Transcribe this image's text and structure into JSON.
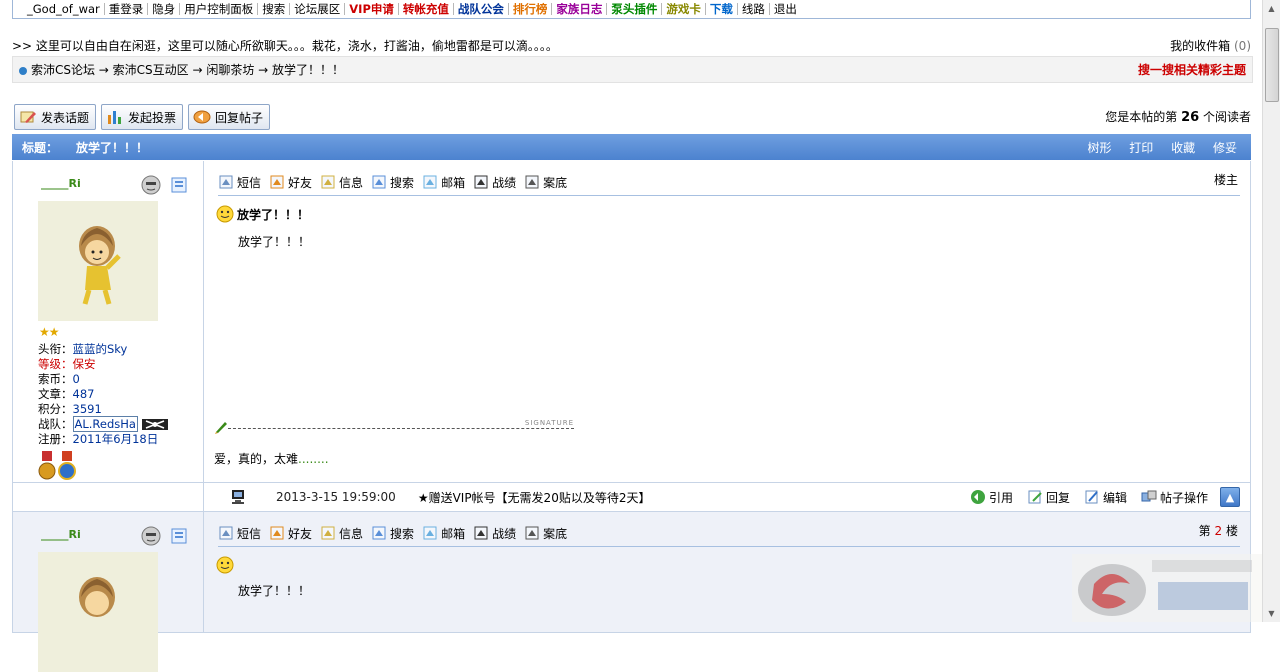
{
  "nav": {
    "items": [
      {
        "label": "_God_of_war",
        "color": "#000000",
        "bold": false
      },
      {
        "label": "重登录",
        "color": "#000000",
        "bold": false
      },
      {
        "label": "隐身",
        "color": "#000000",
        "bold": false
      },
      {
        "label": "用户控制面板",
        "color": "#000000",
        "bold": false
      },
      {
        "label": "搜索",
        "color": "#000000",
        "bold": false
      },
      {
        "label": "论坛展区",
        "color": "#000000",
        "bold": false
      },
      {
        "label": "VIP申请",
        "color": "#cc0000",
        "bold": true
      },
      {
        "label": "转帐充值",
        "color": "#cc0000",
        "bold": true
      },
      {
        "label": "战队公会",
        "color": "#003399",
        "bold": true
      },
      {
        "label": "排行榜",
        "color": "#e07000",
        "bold": true
      },
      {
        "label": "家族日志",
        "color": "#990099",
        "bold": true
      },
      {
        "label": "泵头插件",
        "color": "#008800",
        "bold": true
      },
      {
        "label": "游戏卡",
        "color": "#888800",
        "bold": true
      },
      {
        "label": "下载",
        "color": "#0066cc",
        "bold": true
      },
      {
        "label": "线路",
        "color": "#000000",
        "bold": false
      },
      {
        "label": "退出",
        "color": "#000000",
        "bold": false
      }
    ]
  },
  "announce": {
    "text": ">> 这里可以自由自在闲逛，这里可以随心所欲聊天。。。栽花，浇水，打酱油，偷地雷都是可以滴。。。。",
    "inbox_label": "我的收件箱",
    "inbox_count": "(0)"
  },
  "breadcrumb": {
    "path": "索沛CS论坛 → 索沛CS互动区 → 闲聊茶坊 → 放学了！！！",
    "search_related": "搜一搜相关精彩主题"
  },
  "actions": {
    "new_topic": "发表话题",
    "new_poll": "发起投票",
    "reply": "回复帖子"
  },
  "readers": {
    "prefix": "您是本帖的第",
    "count": "26",
    "suffix": "个阅读者"
  },
  "title_bar": {
    "label": "标题：",
    "title": "放学了！！！",
    "links": [
      "树形",
      "打印",
      "收藏",
      "修妥"
    ]
  },
  "tools": [
    "短信",
    "好友",
    "信息",
    "搜索",
    "邮箱",
    "战绩",
    "案底"
  ],
  "post1": {
    "user": {
      "name": "_____Ri",
      "rank_label": "头衔：",
      "rank": "蓝蓝的Sky",
      "level_label": "等级：",
      "level": "保安",
      "coins_label": "索币：",
      "coins": "0",
      "posts_label": "文章：",
      "posts": "487",
      "score_label": "积分：",
      "score": "3591",
      "team_label": "战队：",
      "team": "AL.RedsHa",
      "reg_label": "注册：",
      "reg": "2011年6月18日"
    },
    "floor": "楼主",
    "title": "放学了！！！",
    "body": "放学了！！！",
    "signature_tag": "SIGNATURE",
    "signature_text": "爱，真的，太难",
    "signature_dots": "........",
    "date": "2013-3-15 19:59:00",
    "vip_note": "★赠送VIP帐号【无需发20贴以及等待2天】",
    "ops": [
      "引用",
      "回复",
      "编辑",
      "帖子操作"
    ]
  },
  "post2": {
    "user_name": "_____Ri",
    "floor_prefix": "第",
    "floor_num": "2",
    "floor_suffix": "楼",
    "body": "放学了！！！"
  },
  "colors": {
    "title_bar": "#5a8fd8",
    "accent_red": "#cc0000",
    "link_blue": "#003399",
    "user_green": "#3a8a19"
  }
}
